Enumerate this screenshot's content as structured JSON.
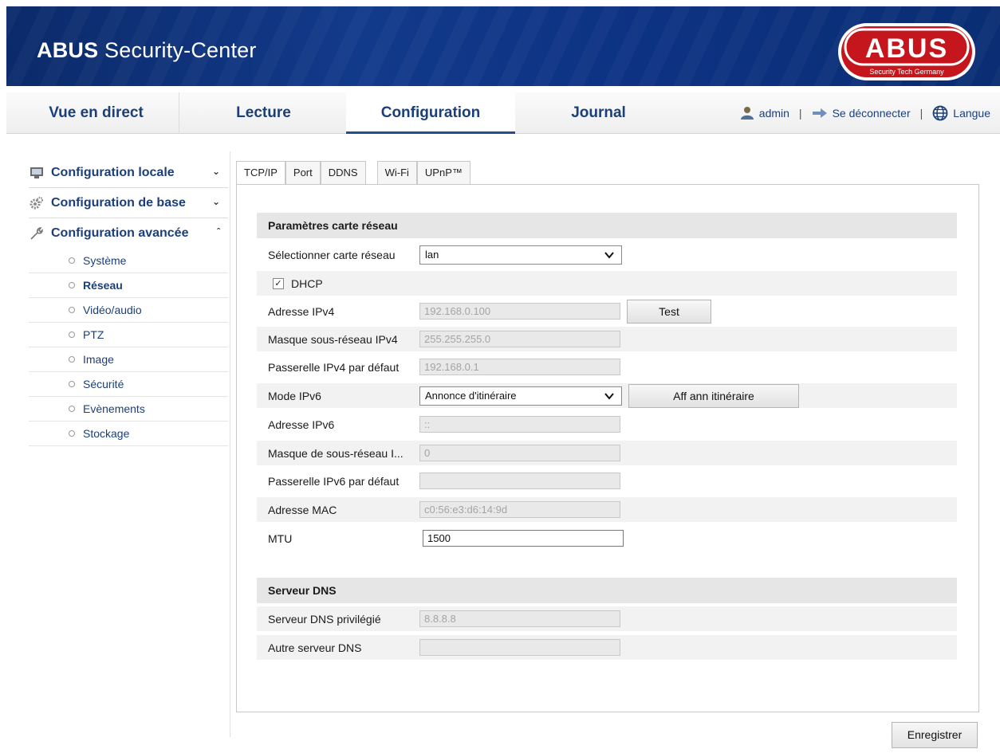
{
  "header": {
    "title_bold": "ABUS",
    "title_rest": " Security-Center",
    "logo_text": "ABUS",
    "logo_tagline": "Security Tech Germany"
  },
  "nav": {
    "tabs": [
      "Vue en direct",
      "Lecture",
      "Configuration",
      "Journal"
    ],
    "active": "Configuration",
    "user": "admin",
    "logout": "Se déconnecter",
    "language": "Langue"
  },
  "sidebar": {
    "groups": [
      {
        "label": "Configuration locale",
        "chevron": "v"
      },
      {
        "label": "Configuration de base",
        "chevron": "v"
      },
      {
        "label": "Configuration avancée",
        "chevron": "^"
      }
    ],
    "items": [
      "Système",
      "Réseau",
      "Vidéo/audio",
      "PTZ",
      "Image",
      "Sécurité",
      "Evènements",
      "Stockage"
    ],
    "active_item": "Réseau"
  },
  "tabs": [
    "TCP/IP",
    "Port",
    "DDNS",
    "Wi-Fi",
    "UPnP™"
  ],
  "network": {
    "section_title": "Paramètres carte réseau",
    "nic_label": "Sélectionner carte réseau",
    "nic_value": "lan",
    "dhcp_label": "DHCP",
    "dhcp_checked": true,
    "ipv4_label": "Adresse IPv4",
    "ipv4_value": "192.168.0.100",
    "test_button": "Test",
    "mask_label": "Masque sous-réseau IPv4",
    "mask_value": "255.255.255.0",
    "gateway_label": "Passerelle IPv4 par défaut",
    "gateway_value": "192.168.0.1",
    "ipv6_mode_label": "Mode IPv6",
    "ipv6_mode_value": "Annonce d'itinéraire",
    "route_button": "Aff ann itinéraire",
    "ipv6_label": "Adresse IPv6",
    "ipv6_value": "::",
    "ipv6_mask_label": "Masque de sous-réseau I...",
    "ipv6_mask_value": "0",
    "ipv6_gateway_label": "Passerelle IPv6 par défaut",
    "ipv6_gateway_value": "",
    "mac_label": "Adresse MAC",
    "mac_value": "c0:56:e3:d6:14:9d",
    "mtu_label": "MTU",
    "mtu_value": "1500"
  },
  "dns": {
    "section_title": "Serveur DNS",
    "primary_label": "Serveur DNS privilégié",
    "primary_value": "8.8.8.8",
    "alt_label": "Autre serveur DNS",
    "alt_value": ""
  },
  "save_button": "Enregistrer",
  "colors": {
    "banner": "#0d3384",
    "link": "#1b3f7a",
    "logo_red": "#c4161c"
  }
}
